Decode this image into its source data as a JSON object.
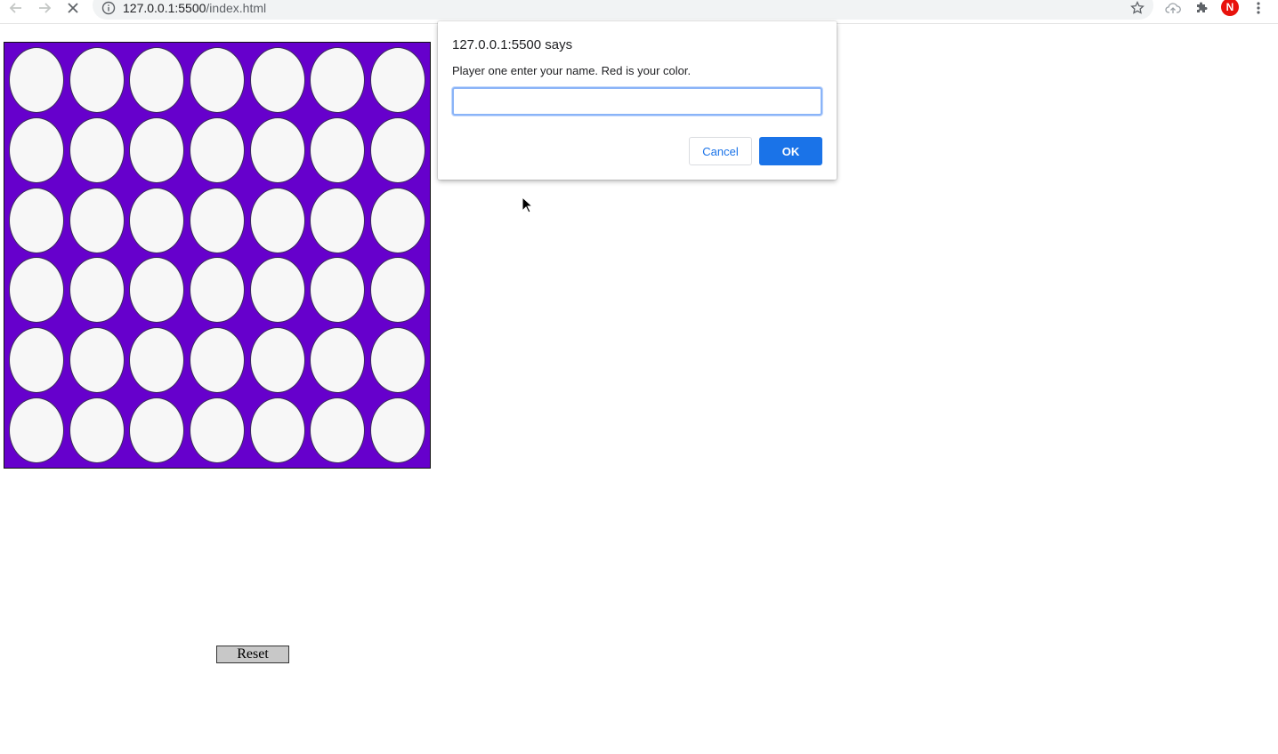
{
  "browser": {
    "url_host": "127.0.0.1:5500",
    "url_path": "/index.html",
    "avatar_letter": "N",
    "icons": [
      "back-arrow-icon",
      "forward-arrow-icon",
      "stop-loading-icon",
      "info-icon",
      "star-icon",
      "cloud-upload-icon",
      "extensions-puzzle-icon",
      "kebab-menu-icon"
    ]
  },
  "board": {
    "rows": 6,
    "columns": 7,
    "board_color": "#6600cc",
    "empty_slot_color": "#f7f7f7"
  },
  "reset_label": "Reset",
  "dialog": {
    "title": "127.0.0.1:5500 says",
    "message": "Player one enter your name. Red is your color.",
    "input_value": "",
    "cancel_label": "Cancel",
    "ok_label": "OK"
  },
  "colors": {
    "accent": "#1a73e8",
    "avatar": "#e8120c"
  }
}
